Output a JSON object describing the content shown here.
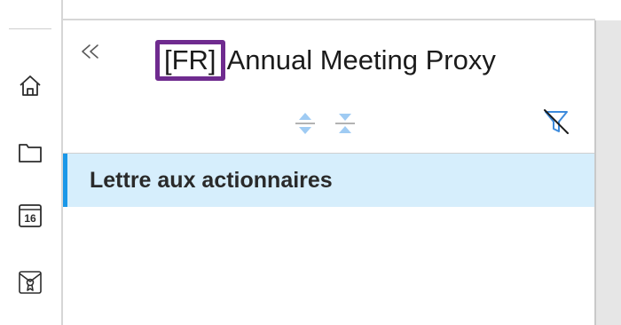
{
  "colors": {
    "accent": "#1b98e8",
    "selected_row_bg": "#d6eefc",
    "lang_badge_border": "#6f2b8f",
    "icon_blue": "#3d8bdc"
  },
  "rail": {
    "items": [
      {
        "name": "home",
        "icon": "home-icon"
      },
      {
        "name": "documents",
        "icon": "folder-icon"
      },
      {
        "name": "calendar",
        "icon": "calendar-icon",
        "number": "16"
      },
      {
        "name": "certificates",
        "icon": "certificate-icon"
      }
    ]
  },
  "header": {
    "collapse_icon": "double-chevron-left-icon",
    "lang_badge": "[FR]",
    "title": "Annual Meeting Proxy"
  },
  "toolbar": {
    "expand_icon": "expand-all-icon",
    "collapse_icon": "collapse-all-icon",
    "filter_icon": "filter-off-icon"
  },
  "list": {
    "items": [
      {
        "label": "Lettre aux actionnaires",
        "selected": true
      }
    ]
  }
}
